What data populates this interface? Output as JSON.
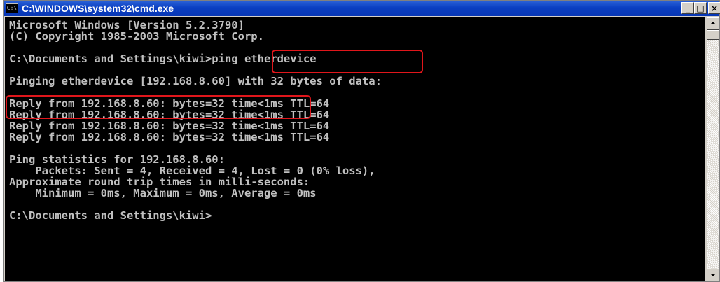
{
  "window": {
    "title": "C:\\WINDOWS\\system32\\cmd.exe",
    "icon_label": "C:\\",
    "controls": {
      "minimize": "_",
      "maximize": "□",
      "close": "×"
    }
  },
  "console": {
    "lines": [
      "Microsoft Windows [Version 5.2.3790]",
      "(C) Copyright 1985-2003 Microsoft Corp.",
      "",
      "C:\\Documents and Settings\\kiwi>ping etherdevice",
      "",
      "Pinging etherdevice [192.168.8.60] with 32 bytes of data:",
      "",
      "Reply from 192.168.8.60: bytes=32 time<1ms TTL=64",
      "Reply from 192.168.8.60: bytes=32 time<1ms TTL=64",
      "Reply from 192.168.8.60: bytes=32 time<1ms TTL=64",
      "Reply from 192.168.8.60: bytes=32 time<1ms TTL=64",
      "",
      "Ping statistics for 192.168.8.60:",
      "    Packets: Sent = 4, Received = 4, Lost = 0 (0% loss),",
      "Approximate round trip times in milli-seconds:",
      "    Minimum = 0ms, Maximum = 0ms, Average = 0ms",
      "",
      "C:\\Documents and Settings\\kiwi>"
    ]
  },
  "colors": {
    "titlebar": "#0a3fc2",
    "console_bg": "#000000",
    "console_text": "#c0c0c0",
    "highlight": "#e0161b"
  }
}
